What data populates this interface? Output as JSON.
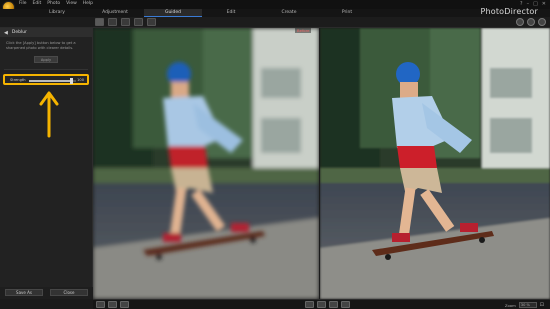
{
  "menu": {
    "items": [
      "File",
      "Edit",
      "Photo",
      "View",
      "Help"
    ],
    "controls": [
      "?",
      "–",
      "□",
      "✕"
    ]
  },
  "tabs": [
    {
      "label": "Library",
      "active": false
    },
    {
      "label": "Adjustment",
      "active": false
    },
    {
      "label": "Guided",
      "active": true
    },
    {
      "label": "Edit",
      "active": false
    },
    {
      "label": "Create",
      "active": false
    },
    {
      "label": "Print",
      "active": false
    }
  ],
  "brand": "PhotoDirector",
  "panel": {
    "title": "Deblur",
    "back_icon": "back-arrow-icon",
    "description": "Click the [Apply] button below to get a sharpened photo with clearer details.",
    "apply_label": "Apply",
    "adjust_text": "Adjust the deblurring strength with the below slider.",
    "slider": {
      "label": "Strength",
      "value": "100",
      "fraction": 0.9
    },
    "save_as_label": "Save As",
    "close_label": "Close"
  },
  "viewer": {
    "before_label": "Before"
  },
  "status": {
    "zoom_label": "Zoom",
    "zoom_value": "30 %"
  },
  "colors": {
    "highlight": "#f5b400",
    "accent": "#3a7bd5"
  }
}
